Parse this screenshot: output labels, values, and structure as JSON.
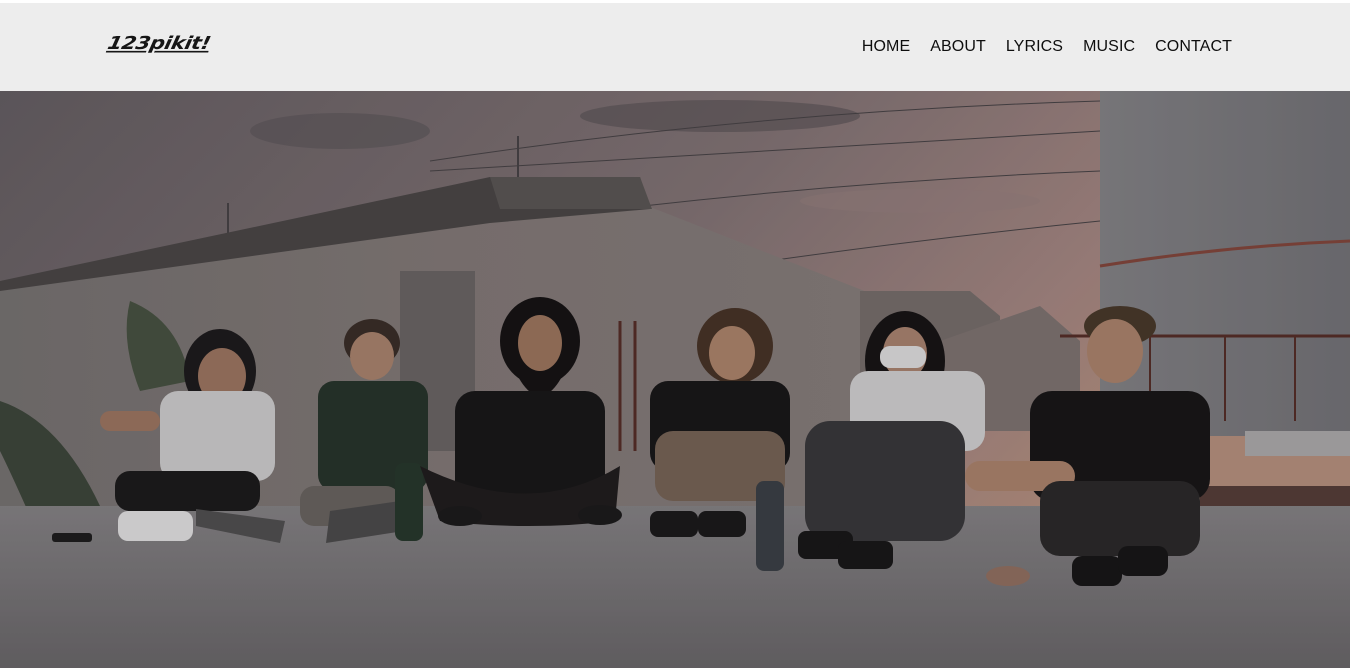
{
  "brand": {
    "logo_text": "123pikit!"
  },
  "nav": {
    "items": [
      {
        "label": "HOME"
      },
      {
        "label": "ABOUT"
      },
      {
        "label": "LYRICS"
      },
      {
        "label": "MUSIC"
      },
      {
        "label": "CONTACT"
      }
    ]
  },
  "colors": {
    "navbar_bg": "#ededed",
    "nav_text": "#0e0e0e",
    "logo_text": "#161616"
  }
}
